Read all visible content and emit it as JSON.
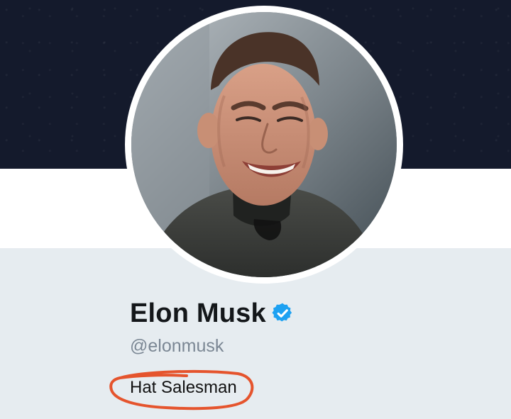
{
  "profile": {
    "name": "Elon Musk",
    "handle": "@elonmusk",
    "bio": "Hat Salesman",
    "verified": true
  },
  "colors": {
    "banner": "#141a2c",
    "page_background": "#e6ecf0",
    "verified_badge": "#1da1f2",
    "annotation": "#e5542d"
  },
  "icons": {
    "verified": "verified-badge-icon"
  }
}
